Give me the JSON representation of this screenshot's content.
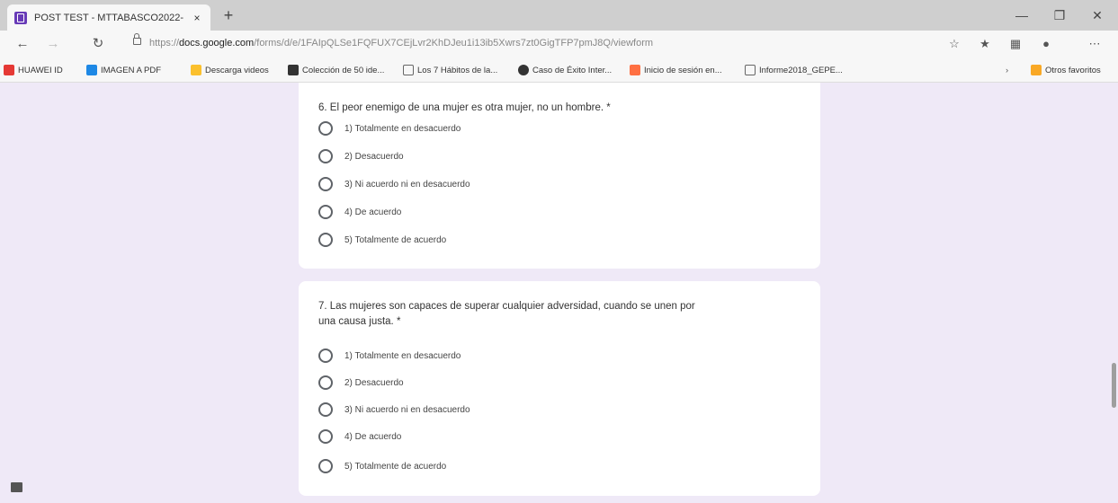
{
  "browser": {
    "tab_title": "POST TEST - MTTABASCO2022-",
    "tab_close": "×",
    "new_tab": "+",
    "url_prefix": "https://",
    "url_host": "docs.google.com",
    "url_path": "/forms/d/e/1FAIpQLSe1FQFUX7CEjLvr2KhDJeu1i13ib5Xwrs7zt0GigTFP7pmJ8Q/viewform"
  },
  "bookmarks": [
    {
      "label": "HUAWEI ID",
      "color": "#e53935"
    },
    {
      "label": "IMAGEN A PDF",
      "color": "#1e88e5"
    },
    {
      "label": "Descarga videos",
      "color": "#fbc02d"
    },
    {
      "label": "Colección de 50 ide...",
      "color": "#333333"
    },
    {
      "label": "Los 7 Hábitos de la...",
      "color": "#ffffff"
    },
    {
      "label": "Caso de Éxito Inter...",
      "color": "#333333"
    },
    {
      "label": "Inicio de sesión en...",
      "color": "#ff7043"
    },
    {
      "label": "Informe2018_GEPE...",
      "color": "#ffffff"
    },
    {
      "label": "Otros favoritos",
      "color": "#f9a825"
    }
  ],
  "questions": [
    {
      "text": "6. El peor enemigo de una mujer es otra mujer, no un hombre. *",
      "options": [
        "1) Totalmente en desacuerdo",
        "2) Desacuerdo",
        "3) Ni acuerdo ni en desacuerdo",
        "4) De acuerdo",
        "5) Totalmente de acuerdo"
      ]
    },
    {
      "text_line1": "7. Las mujeres son capaces de superar cualquier adversidad, cuando se unen por",
      "text_line2": "una causa justa. *",
      "options": [
        "1) Totalmente en desacuerdo",
        "2) Desacuerdo",
        "3) Ni acuerdo ni en desacuerdo",
        "4) De acuerdo",
        "5) Totalmente de acuerdo"
      ]
    }
  ]
}
